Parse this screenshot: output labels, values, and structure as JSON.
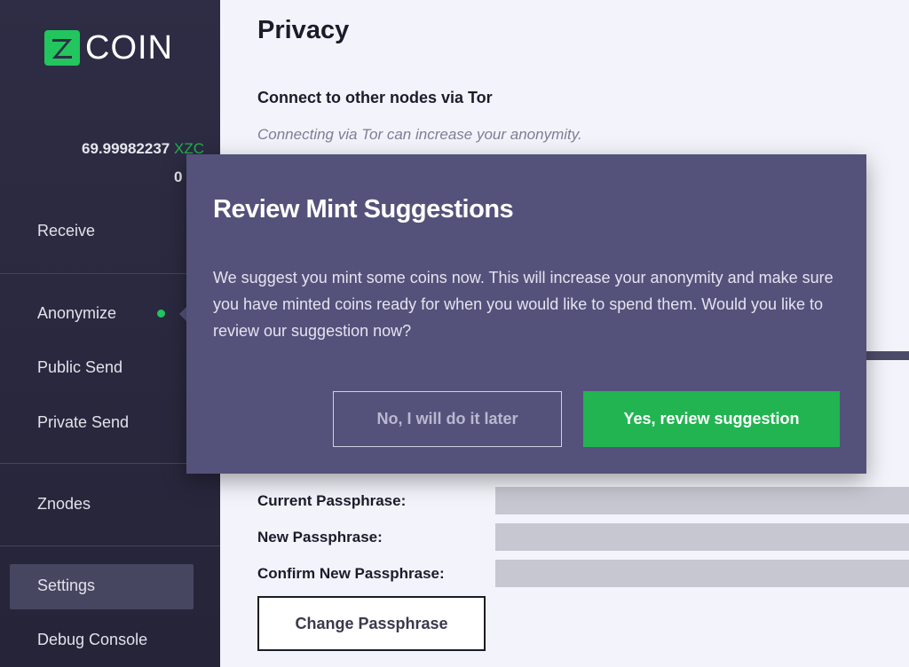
{
  "app": {
    "logo_text": "COIN",
    "brand_color": "#22b04c"
  },
  "sidebar": {
    "balance_amount": "69.99982237",
    "balance_unit": "XZC",
    "balance_secondary": "0",
    "items": [
      {
        "label": "Receive"
      },
      {
        "label": "Anonymize"
      },
      {
        "label": "Public Send"
      },
      {
        "label": "Private Send"
      },
      {
        "label": "Znodes"
      },
      {
        "label": "Settings"
      },
      {
        "label": "Debug Console"
      }
    ],
    "active_item": "Settings"
  },
  "main": {
    "page_title": "Privacy",
    "tor_title": "Connect to other nodes via Tor",
    "tor_desc": "Connecting via Tor can increase your anonymity.",
    "fields": [
      {
        "label": "Current Passphrase:",
        "value": ""
      },
      {
        "label": "New Passphrase:",
        "value": ""
      },
      {
        "label": "Confirm New Passphrase:",
        "value": ""
      }
    ],
    "change_button": "Change Passphrase"
  },
  "modal": {
    "title": "Review Mint Suggestions",
    "body": "We suggest you mint some coins now. This will increase your anonymity and make sure you have minted coins ready for when you would like to spend them. Would you like to review our suggestion now?",
    "secondary_button": "No, I will do it later",
    "primary_button": "Yes, review suggestion",
    "background_color": "#54527a",
    "primary_color": "#22b451"
  }
}
